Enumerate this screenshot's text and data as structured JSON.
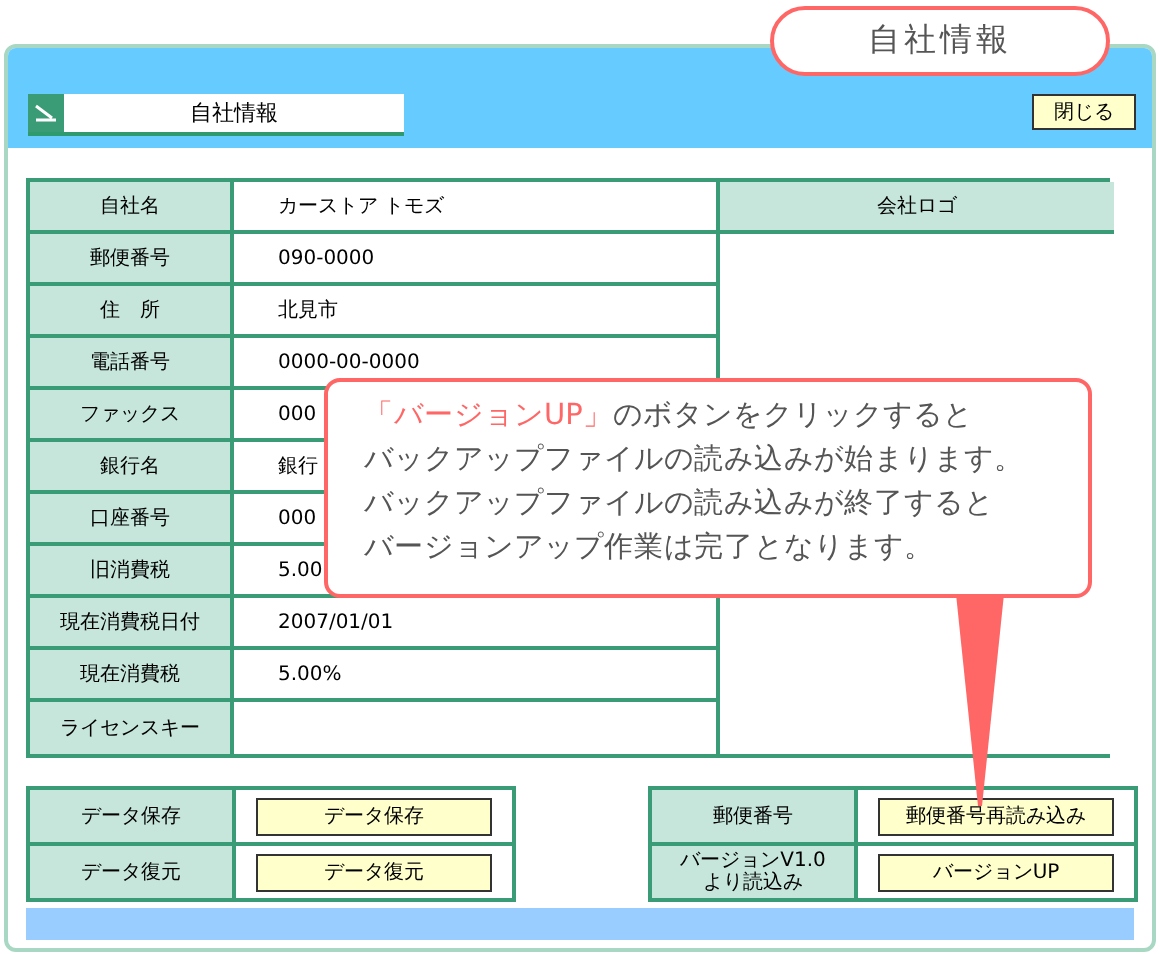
{
  "tab_title": "自社情報",
  "header": {
    "title": "自社情報",
    "close_button": "閉じる"
  },
  "company_table": {
    "rows": [
      {
        "label": "自社名",
        "value": "カーストア トモズ"
      },
      {
        "label": "郵便番号",
        "value": "090-0000"
      },
      {
        "label": "住　所",
        "value": "北見市"
      },
      {
        "label": "電話番号",
        "value": "0000-00-0000"
      },
      {
        "label": "ファックス",
        "value": "000"
      },
      {
        "label": "銀行名",
        "value": "銀行"
      },
      {
        "label": "口座番号",
        "value": "000"
      },
      {
        "label": "旧消費税",
        "value": "5.00"
      },
      {
        "label": "現在消費税日付",
        "value": "2007/01/01"
      },
      {
        "label": "現在消費税",
        "value": "5.00%"
      },
      {
        "label": "ライセンスキー",
        "value": ""
      }
    ],
    "logo_heading": "会社ロゴ"
  },
  "data_actions": [
    {
      "label": "データ保存",
      "button": "データ保存"
    },
    {
      "label": "データ復元",
      "button": "データ復元"
    }
  ],
  "update_actions": [
    {
      "label": "郵便番号",
      "button": "郵便番号再読み込み"
    },
    {
      "label": "バージョンV1.0\nより読込み",
      "button": "バージョンUP"
    }
  ],
  "callout": {
    "highlight": "「バージョンUP」",
    "lines": [
      "のボタンをクリックすると",
      "バックアップファイルの読み込みが始まります。",
      "バックアップファイルの読み込みが終了すると",
      "バージョンアップ作業は完了となります。"
    ]
  }
}
